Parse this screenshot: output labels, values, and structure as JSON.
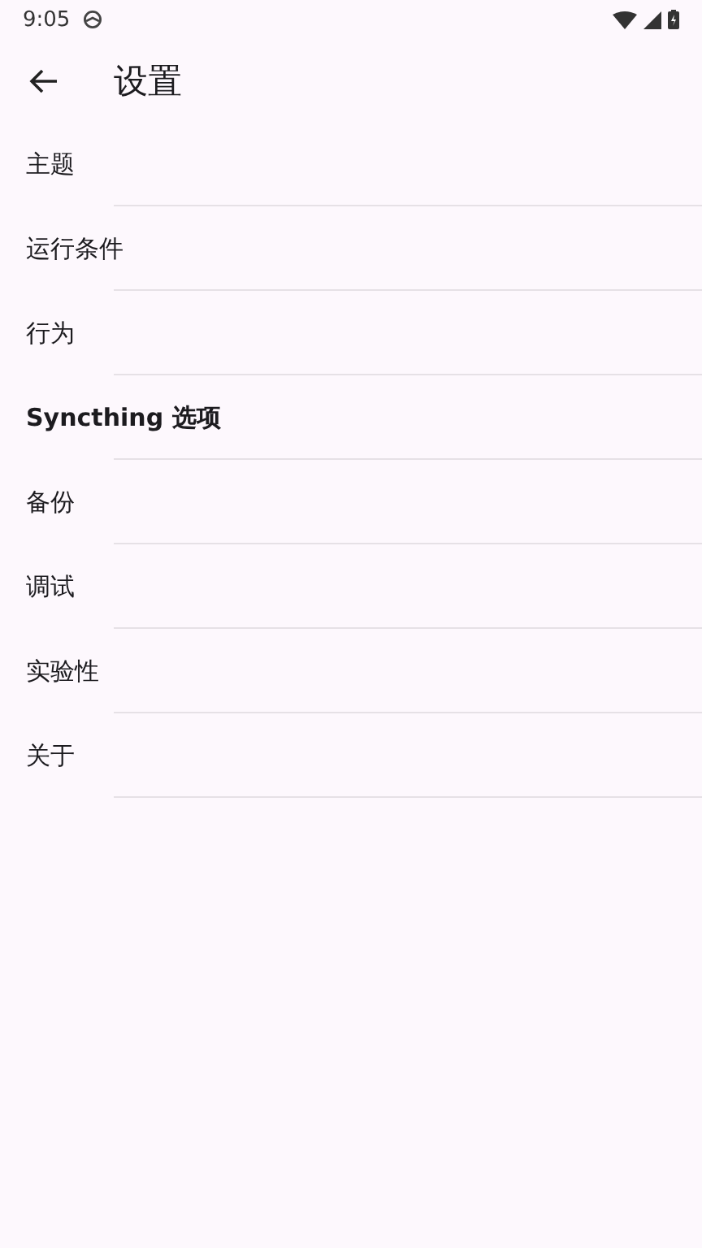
{
  "status_bar": {
    "time": "9:05"
  },
  "app_bar": {
    "title": "设置"
  },
  "items": [
    {
      "label": "主题",
      "bold": false
    },
    {
      "label": "运行条件",
      "bold": false
    },
    {
      "label": "行为",
      "bold": false
    },
    {
      "label": "Syncthing 选项",
      "bold": true
    },
    {
      "label": "备份",
      "bold": false
    },
    {
      "label": "调试",
      "bold": false
    },
    {
      "label": "实验性",
      "bold": false
    },
    {
      "label": "关于",
      "bold": false
    }
  ]
}
